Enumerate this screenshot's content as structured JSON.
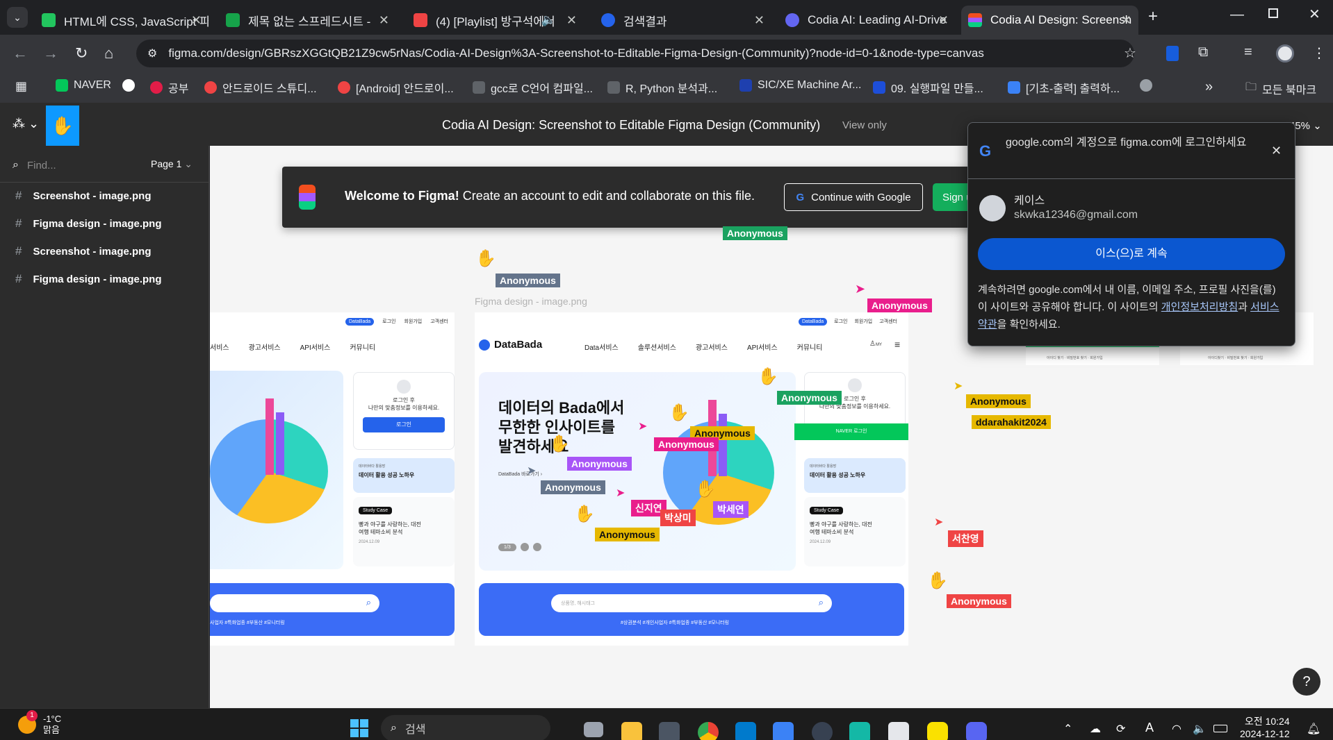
{
  "browser": {
    "tabs": [
      {
        "title": "HTML에 CSS, JavaScript 파",
        "color": "#22c55e",
        "glyph": "V"
      },
      {
        "title": "제목 없는 스프레드시트 - ",
        "color": "#16a34a",
        "glyph": "+"
      },
      {
        "title": "(4) [Playlist] 방구석에서",
        "color": "#ef4444",
        "glyph": "▶"
      },
      {
        "title": "검색결과",
        "color": "#2563eb",
        "glyph": "◐"
      },
      {
        "title": "Codia AI: Leading AI-Drive",
        "color": "#6366f1",
        "glyph": "≡"
      },
      {
        "title": "Codia AI Design: Screensh",
        "color": "#f24e1e",
        "glyph": "F"
      }
    ],
    "url": "figma.com/design/GBRszXGGtQB21Z9cw5rNas/Codia-AI-Design%3A-Screenshot-to-Editable-Figma-Design-(Community)?node-id=0-1&node-type=canvas",
    "bookmarks": [
      {
        "label": "NAVER",
        "color": "#03c75a"
      },
      {
        "label": "",
        "color": "#ffffff"
      },
      {
        "label": "공부",
        "color": "#e11d48"
      },
      {
        "label": "안드로이드 스튜디...",
        "color": "#ef4444"
      },
      {
        "label": "[Android] 안드로이...",
        "color": "#ef4444"
      },
      {
        "label": "gcc로 C언어 컴파일...",
        "color": "#9aa0a6"
      },
      {
        "label": "R, Python 분석과...",
        "color": "#9aa0a6"
      },
      {
        "label": "SIC/XE Machine Ar...",
        "color": "#1e40af"
      },
      {
        "label": "09. 실행파일 만들...",
        "color": "#1d4ed8"
      },
      {
        "label": "[기초-출력] 출력하...",
        "color": "#3b82f6"
      },
      {
        "label": "",
        "color": "#9aa0a6"
      }
    ],
    "all_bookmarks": "모든 북마크"
  },
  "figma": {
    "file_title": "Codia AI Design: Screenshot to Editable Figma Design (Community)",
    "view_only": "View only",
    "zoom": "45%",
    "find_placeholder": "Find...",
    "page": "Page 1",
    "layers": [
      "Screenshot - image.png",
      "Figma design - image.png",
      "Screenshot - image.png",
      "Figma design - image.png"
    ],
    "banner": {
      "bold": "Welcome to Figma!",
      "text": "Create an account to edit and collaborate on this file.",
      "google_btn": "Continue with Google",
      "signup_btn": "Sign u"
    },
    "frame_label": "Figma design - image.png",
    "help": "?"
  },
  "design": {
    "logo": "DataBada",
    "nav": [
      "Data서비스",
      "솔루션서비스",
      "광고서비스",
      "API서비스",
      "커뮤니티"
    ],
    "nav_left": [
      "서비스",
      "광고서비스",
      "API서비스",
      "커뮤니티"
    ],
    "top_links": [
      "DataBada",
      "로그인",
      "회원가입",
      "고객센터"
    ],
    "my": "MY",
    "hero_text": "데이터의 Bada에서\n무한한 인사이트를\n발견하세요",
    "hero_link": "DataBada 바로가기",
    "pager": "1/3",
    "login_note": "로그인 후\n나만의 맞춤정보를 이용하세요.",
    "login_btn": "로그인",
    "naver_btn": "NAVER 로그인",
    "card_small": "데이터바다 활용방",
    "card_title": "데이터 활용 성공 노하우",
    "case_badge": "Study Case",
    "case_text": "빵과 야구를 사랑하는, 대전\n여행 테마소비 분석",
    "case_date": "2024.12.09",
    "search_placeholder": "상품명, 해시태그",
    "hashtags": "#상권분석 #개인사업자 #특화업종 #부동산 #모니터링",
    "hashtags_left": "사업자 #특화업종 #부동산 #모니터링",
    "far_links": [
      "아이디 찾기 · 비밀번호 찾기 · 회원가입",
      "아이디찾기 · 비밀번호 찾기 · 회원가입"
    ]
  },
  "cursors": [
    {
      "label": "Anonymous",
      "color": "#1aa260"
    },
    {
      "label": "Anonymous",
      "color": "#64748b"
    },
    {
      "label": "Anonymous",
      "color": "#e91e8c"
    },
    {
      "label": "Anonymous",
      "color": "#1aa260"
    },
    {
      "label": "Anonymous",
      "color": "#e6b800"
    },
    {
      "label": "Anonymous",
      "color": "#e91e8c"
    },
    {
      "label": "Anonymous",
      "color": "#a855f7"
    },
    {
      "label": "Anonymous",
      "color": "#64748b"
    },
    {
      "label": "신지연",
      "color": "#e91e8c"
    },
    {
      "label": "박상미",
      "color": "#ef4444"
    },
    {
      "label": "박세연",
      "color": "#a855f7"
    },
    {
      "label": "Anonymous",
      "color": "#e6b800"
    },
    {
      "label": "Anonymous",
      "color": "#e6b800"
    },
    {
      "label": "ddarahakit2024",
      "color": "#e6b800"
    },
    {
      "label": "서찬영",
      "color": "#ef4444"
    },
    {
      "label": "Anonymous",
      "color": "#ef4444"
    }
  ],
  "google_popup": {
    "title": "google.com의 계정으로 figma.com에 로그인하세요",
    "name": "케이스",
    "email": "skwka12346@gmail.com",
    "continue_btn": "이스(으)로 계속",
    "body1": "계속하려면 google.com에서 내 이름, 이메일 주소, 프로필 사진을(를) 이 사이트와 공유해야 합니다. 이 사이트의 ",
    "privacy": "개인정보처리방침",
    "body2": "과 ",
    "terms": "서비스 약관",
    "body3": "을 확인하세요."
  },
  "taskbar": {
    "weather_temp": "-1°C",
    "weather_desc": "맑음",
    "weather_badge": "1",
    "search": "검색",
    "time": "오전 10:24",
    "date": "2024-12-12"
  }
}
